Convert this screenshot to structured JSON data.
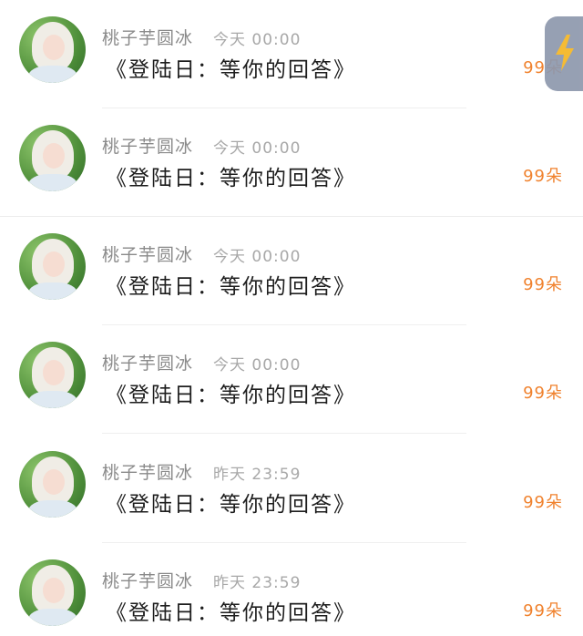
{
  "feed": {
    "items": [
      {
        "name": "桃子芋圆冰",
        "time": "今天 00:00",
        "title": "《登陆日：等你的回答》",
        "count": "99朵"
      },
      {
        "name": "桃子芋圆冰",
        "time": "今天 00:00",
        "title": "《登陆日：等你的回答》",
        "count": "99朵"
      },
      {
        "name": "桃子芋圆冰",
        "time": "今天 00:00",
        "title": "《登陆日：等你的回答》",
        "count": "99朵"
      },
      {
        "name": "桃子芋圆冰",
        "time": "今天 00:00",
        "title": "《登陆日：等你的回答》",
        "count": "99朵"
      },
      {
        "name": "桃子芋圆冰",
        "time": "昨天 23:59",
        "title": "《登陆日：等你的回答》",
        "count": "99朵"
      },
      {
        "name": "桃子芋圆冰",
        "time": "昨天 23:59",
        "title": "《登陆日：等你的回答》",
        "count": "99朵"
      }
    ]
  },
  "float_button": {
    "icon": "lightning-icon"
  },
  "colors": {
    "count": "#f0822e",
    "lightning": "#f5b623",
    "float_bg": "#8e98ad"
  }
}
